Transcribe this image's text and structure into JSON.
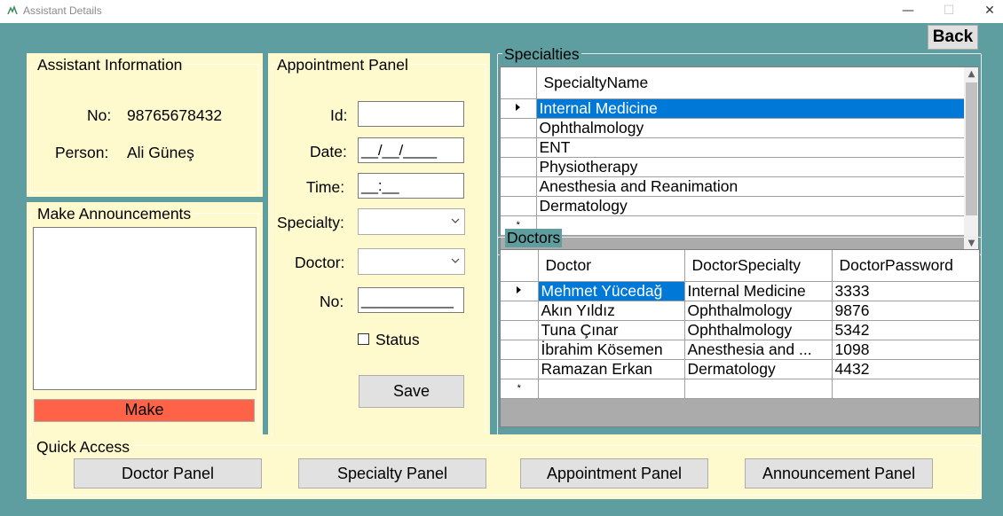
{
  "window": {
    "title": "Assistant Details",
    "controls": {
      "minimize": "—",
      "maximize": "☐",
      "close": "✕"
    }
  },
  "back_button": "Back",
  "assistant_info": {
    "title": "Assistant Information",
    "no_label": "No:",
    "no_value": "98765678432",
    "person_label": "Person:",
    "person_value": "Ali Güneş"
  },
  "announcements": {
    "title": "Make Announcements",
    "text": "",
    "make_button": "Make",
    "make_button_color": "#ff6347"
  },
  "appointment_panel": {
    "title": "Appointment Panel",
    "id_label": "Id:",
    "id_value": "",
    "date_label": "Date:",
    "date_value": "__/__/____",
    "time_label": "Time:",
    "time_value": "__:__",
    "specialty_label": "Specialty:",
    "specialty_value": "",
    "doctor_label": "Doctor:",
    "doctor_value": "",
    "no_label": "No:",
    "no_value": "___________",
    "status_label": "Status",
    "status_checked": false,
    "save_button": "Save"
  },
  "specialties": {
    "title": "Specialties",
    "columns": [
      "SpecialtyName"
    ],
    "rows": [
      [
        "Internal Medicine"
      ],
      [
        "Ophthalmology"
      ],
      [
        "ENT"
      ],
      [
        "Physiotherapy"
      ],
      [
        "Anesthesia and Reanimation"
      ],
      [
        "Dermatology"
      ]
    ],
    "selected_row": 0,
    "new_row_marker": "*"
  },
  "doctors": {
    "title": "Doctors",
    "columns": [
      "Doctor",
      "DoctorSpecialty",
      "DoctorPassword"
    ],
    "rows": [
      [
        "Mehmet Yücedağ",
        "Internal Medicine",
        "3333"
      ],
      [
        "Akın Yıldız",
        "Ophthalmology",
        "9876"
      ],
      [
        "Tuna Çınar",
        "Ophthalmology",
        "5342"
      ],
      [
        "İbrahim Kösemen",
        "Anesthesia and ...",
        "1098"
      ],
      [
        "Ramazan Erkan",
        "Dermatology",
        "4432"
      ]
    ],
    "selected_row": 0,
    "new_row_marker": "*"
  },
  "quick_access": {
    "title": "Quick Access",
    "buttons": [
      "Doctor Panel",
      "Specialty Panel",
      "Appointment Panel",
      "Announcement Panel"
    ]
  },
  "colors": {
    "form_background": "#5f9ea0",
    "panel_background": "#fffacd",
    "selection": "#0078d7"
  }
}
